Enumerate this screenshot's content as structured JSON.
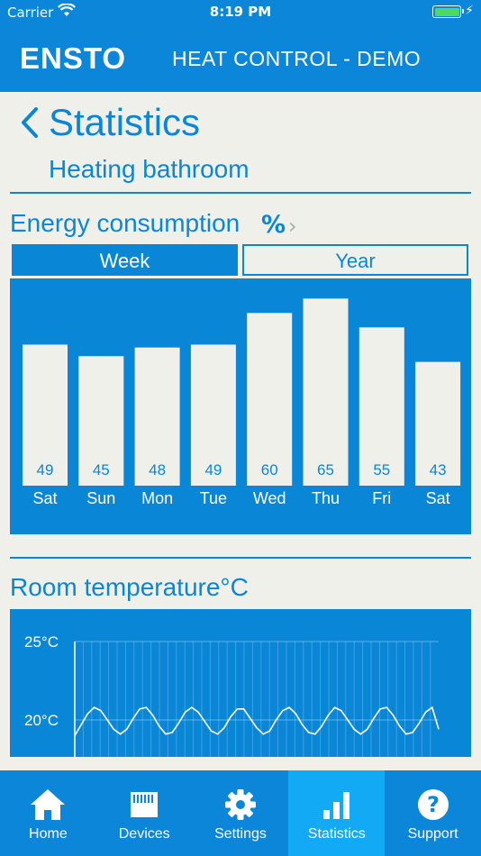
{
  "status_bar": {
    "carrier": "Carrier",
    "time": "8:19 PM"
  },
  "header": {
    "brand": "ENSTO",
    "title": "HEAT CONTROL - DEMO"
  },
  "page": {
    "title": "Statistics",
    "subtitle": "Heating bathroom"
  },
  "energy": {
    "title": "Energy consumption",
    "unit": "%",
    "tabs": [
      {
        "label": "Week",
        "selected": true
      },
      {
        "label": "Year",
        "selected": false
      }
    ]
  },
  "chart_data": [
    {
      "type": "bar",
      "categories": [
        "Sat",
        "Sun",
        "Mon",
        "Tue",
        "Wed",
        "Thu",
        "Fri",
        "Sat"
      ],
      "values": [
        49,
        45,
        48,
        49,
        60,
        65,
        55,
        43
      ],
      "ylim": [
        0,
        72
      ],
      "grid": false
    },
    {
      "type": "line",
      "title": "Room temperature°C",
      "yticks": [
        "25°C",
        "20°C"
      ],
      "ytick_values": [
        25,
        20
      ],
      "grid": true,
      "x": [
        0,
        1,
        2,
        3,
        4,
        5,
        6,
        7,
        8,
        9,
        10,
        11,
        12,
        13,
        14,
        15,
        16,
        17,
        18,
        19,
        20,
        21,
        22,
        23,
        24,
        25,
        26,
        27,
        28,
        29,
        30,
        31,
        32,
        33,
        34,
        35,
        36,
        37,
        38,
        39,
        40,
        41,
        42,
        43,
        44,
        45,
        46,
        47,
        48,
        49,
        50,
        51,
        52,
        53,
        54,
        55,
        56
      ],
      "y": [
        19.0,
        19.7,
        20.4,
        20.8,
        20.6,
        20.0,
        19.4,
        19.1,
        19.4,
        20.1,
        20.7,
        20.8,
        20.3,
        19.6,
        19.1,
        19.2,
        19.8,
        20.5,
        20.8,
        20.5,
        19.9,
        19.3,
        19.1,
        19.5,
        20.2,
        20.7,
        20.7,
        20.1,
        19.5,
        19.1,
        19.3,
        20.0,
        20.6,
        20.8,
        20.4,
        19.7,
        19.2,
        19.1,
        19.6,
        20.3,
        20.8,
        20.6,
        20.0,
        19.4,
        19.1,
        19.4,
        20.1,
        20.7,
        20.8,
        20.3,
        19.6,
        19.1,
        19.2,
        19.8,
        20.5,
        20.8,
        19.4
      ]
    }
  ],
  "temperature": {
    "title": "Room temperature°C"
  },
  "tabbar": {
    "items": [
      {
        "label": "Home",
        "icon": "home-icon",
        "active": false
      },
      {
        "label": "Devices",
        "icon": "device-icon",
        "active": false
      },
      {
        "label": "Settings",
        "icon": "gear-icon",
        "active": false
      },
      {
        "label": "Statistics",
        "icon": "bar-chart-icon",
        "active": true
      },
      {
        "label": "Support",
        "icon": "question-icon",
        "active": false
      }
    ]
  },
  "colors": {
    "brand_blue": "#0a86d6",
    "active_tab": "#12aaf5",
    "background": "#f0f0eb",
    "bar_fill": "#f0f0eb"
  }
}
